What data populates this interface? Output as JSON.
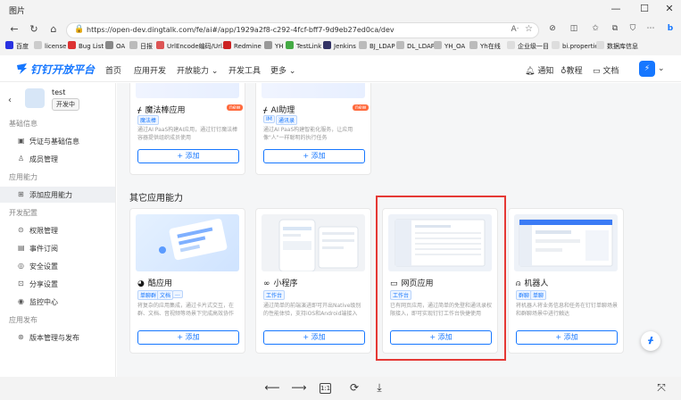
{
  "viewer": {
    "title": "图片",
    "window_buttons": [
      "—",
      "☐",
      "✕"
    ],
    "bottom_tools": [
      "⟵",
      "⟶",
      "1:1",
      "⟳",
      "⤓",
      "⤧"
    ]
  },
  "browser": {
    "url": "https://open-dev.dingtalk.com/fe/ai#/app/1929a2f8-c292-4fcf-bff7-9d9eb27ed0ca/dev",
    "bookmarks": [
      "百度",
      "license",
      "Bug List",
      "OA",
      "日报",
      "UrlEncode编码/Url...",
      "Redmine",
      "YH",
      "TestLink",
      "Jenkins",
      "BJ_LDAP",
      "DL_LDAP",
      "YH_OA",
      "Yh在线",
      "企业级一目",
      "bi.properties",
      "数据库信息"
    ]
  },
  "header": {
    "logo": "钉钉开放平台",
    "nav": [
      "首页",
      "应用开发",
      "开放能力 ⌄",
      "开发工具",
      "更多 ⌄"
    ],
    "notify": "通知",
    "tutorial": "教程",
    "docs": "文档"
  },
  "sidebar": {
    "app_name": "test",
    "app_status": "开发中",
    "groups": [
      {
        "label": "基础信息",
        "items": [
          {
            "icon": "▣",
            "label": "凭证与基础信息"
          },
          {
            "icon": "♙",
            "label": "成员管理"
          }
        ]
      },
      {
        "label": "应用能力",
        "items": [
          {
            "icon": "⊞",
            "label": "添加应用能力",
            "active": true
          }
        ]
      },
      {
        "label": "开发配置",
        "items": [
          {
            "icon": "⊙",
            "label": "权限管理"
          },
          {
            "icon": "▤",
            "label": "事件订阅"
          },
          {
            "icon": "◎",
            "label": "安全设置"
          },
          {
            "icon": "⊡",
            "label": "分享设置"
          },
          {
            "icon": "◉",
            "label": "监控中心"
          }
        ]
      },
      {
        "label": "应用发布",
        "items": [
          {
            "icon": "⊛",
            "label": "版本管理与发布"
          }
        ]
      }
    ]
  },
  "main": {
    "top_cards": [
      {
        "title": "魔法棒应用",
        "tags": [
          "魔法棒"
        ],
        "desc": "通过AI PaaS构建AI应用，通过钉钉魔法棒容器提供组织成员使用",
        "add": "+ 添加",
        "badge": "new"
      },
      {
        "title": "AI助理",
        "tags": [
          "IM",
          "通讯录"
        ],
        "desc": "通过AI PaaS构建智能化服务，让应用像\"人\"一样聪明的执行任务",
        "add": "+ 添加",
        "badge": "new"
      }
    ],
    "section_title": "其它应用能力",
    "cards": [
      {
        "title": "酷应用",
        "tags": [
          "单聊群",
          "文档",
          "..."
        ],
        "desc": "将复杂的应用集成，通过卡片式交互，在群、文档、音视频等场景下完成高效协作",
        "add": "+ 添加"
      },
      {
        "title": "小程序",
        "tags": [
          "工作台"
        ],
        "desc": "通过简单的前端演进即可开出Native级别的性能体验，支持iOS和Android端接入",
        "add": "+ 添加"
      },
      {
        "title": "网页应用",
        "tags": [
          "工作台"
        ],
        "desc": "已有网页应用，通过简单的免登和通讯录权限接入，即可实现钉钉工作台快捷使用",
        "add": "+ 添加"
      },
      {
        "title": "机器人",
        "tags": [
          "群聊",
          "单聊"
        ],
        "desc": "将机器人将业务信息和任务在钉钉单聊场景和群聊场景中进行触达",
        "add": "+ 添加"
      }
    ]
  },
  "colors": {
    "brand": "#1677ff",
    "highlight": "#e53935",
    "new": "#ff6a3d"
  }
}
